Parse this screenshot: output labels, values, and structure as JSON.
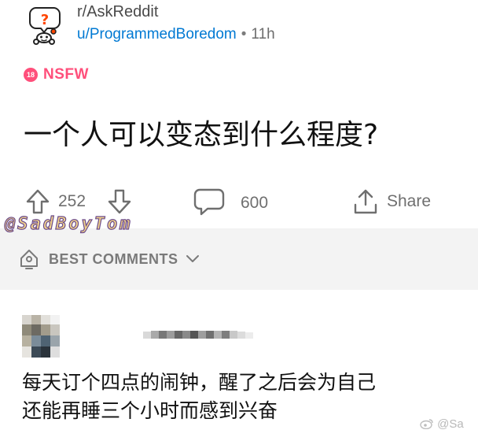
{
  "post": {
    "subreddit": "r/AskReddit",
    "author": "u/ProgrammedBoredom",
    "separator": "•",
    "time_ago": "11h",
    "nsfw_badge": "18",
    "nsfw_label": "NSFW",
    "title": "一个人可以变态到什么程度?"
  },
  "actions": {
    "upvotes": "252",
    "comments": "600",
    "share_label": "Share"
  },
  "watermark": "@SadBoyTom",
  "comments_section": {
    "sort_label": "BEST COMMENTS"
  },
  "comment": {
    "lines": [
      "每天订个四点的闹钟，醒了之后会为自己",
      "还能再睡三个小时而感到兴奋"
    ]
  },
  "footer_mark": "@Sa",
  "colors": {
    "accent_blue": "#0079d3",
    "nsfw_pink": "#ff4f7b",
    "muted_gray": "#6f6f6f",
    "sort_bg": "#f3f3f3"
  },
  "icons": [
    "question-mascot-icon",
    "upvote-arrow-icon",
    "downvote-arrow-icon",
    "comment-bubble-icon",
    "share-icon",
    "bell-icon",
    "chevron-down-icon",
    "weibo-icon"
  ]
}
